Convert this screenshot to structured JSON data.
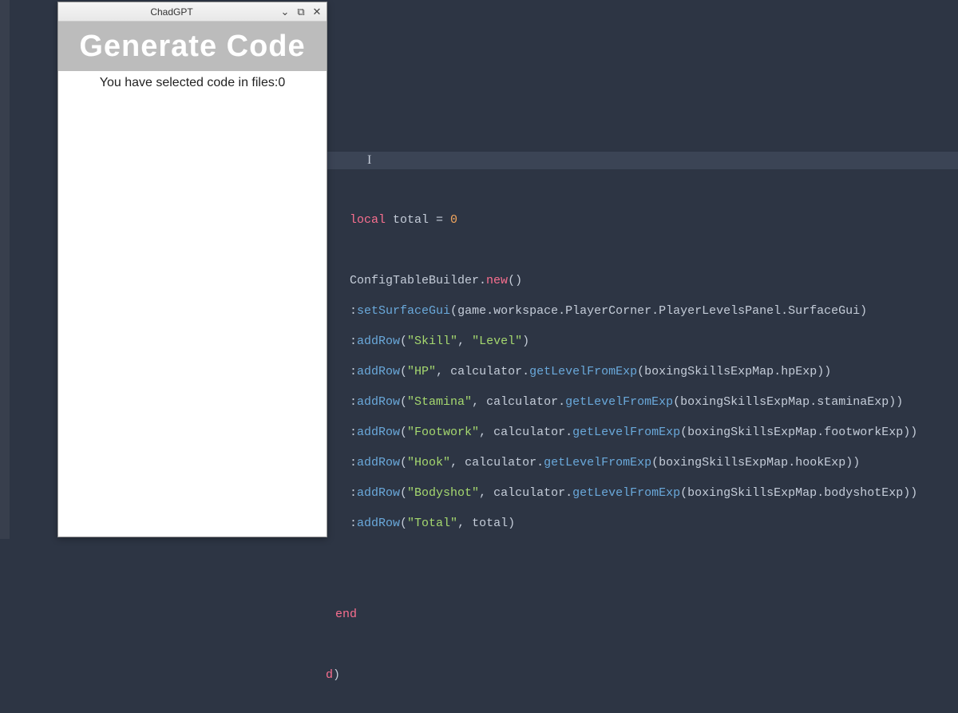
{
  "plugin": {
    "window_title": "ChadGPT",
    "banner_text": "Generate Code",
    "status_text": "You have selected code in files:0"
  },
  "code": {
    "line_local": "local",
    "line_total_var": " total ",
    "line_eq": "=",
    "line_zero": " 0",
    "ctb": "ConfigTableBuilder",
    "new_call": "new",
    "setSurfaceGui": "setSurfaceGui",
    "gui_path": "game.workspace.PlayerCorner.PlayerLevelsPanel.SurfaceGui",
    "addRow": "addRow",
    "skill": "\"Skill\"",
    "level": "\"Level\"",
    "hp": "\"HP\"",
    "stamina": "\"Stamina\"",
    "footwork": "\"Footwork\"",
    "hook": "\"Hook\"",
    "bodyshot": "\"Bodyshot\"",
    "total_str": "\"Total\"",
    "calculator": "calculator",
    "getLevelFromExp": "getLevelFromExp",
    "map": "boxingSkillsExpMap",
    "hpExp": "hpExp",
    "staminaExp": "staminaExp",
    "footworkExp": "footworkExp",
    "hookExp": "hookExp",
    "bodyshotExp": "bodyshotExp",
    "total_var": "total",
    "end_kw": "end",
    "trailing": "d)"
  }
}
